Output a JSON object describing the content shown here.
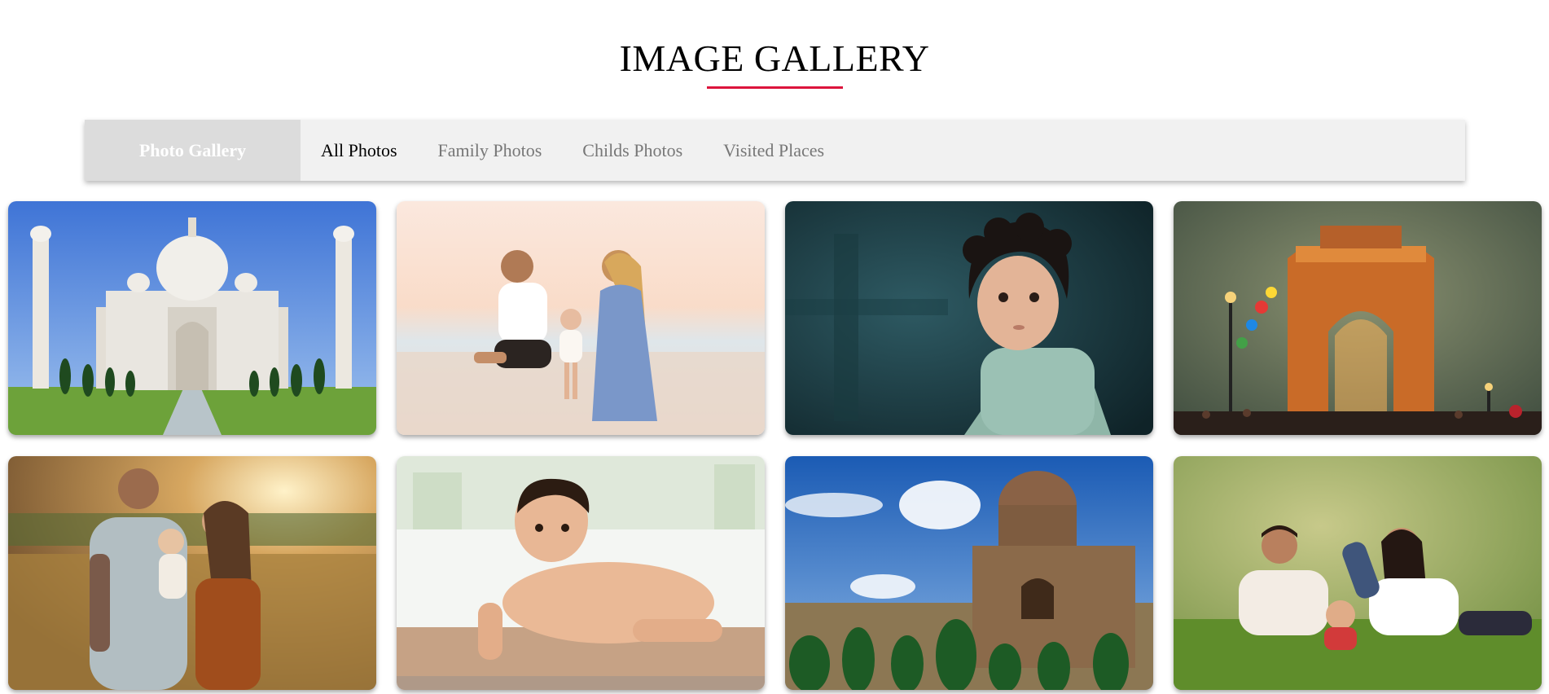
{
  "header": {
    "title": "IMAGE GALLERY",
    "accent_color": "#dc143c"
  },
  "filter_bar": {
    "brand": "Photo Gallery",
    "tabs": [
      {
        "label": "All Photos",
        "active": true
      },
      {
        "label": "Family Photos",
        "active": false
      },
      {
        "label": "Childs Photos",
        "active": false
      },
      {
        "label": "Visited Places",
        "active": false
      }
    ]
  },
  "gallery": {
    "photos": [
      {
        "subject": "taj-mahal",
        "category": "Visited Places"
      },
      {
        "subject": "family-beach",
        "category": "Family Photos"
      },
      {
        "subject": "curly-haired-boy",
        "category": "Childs Photos"
      },
      {
        "subject": "india-gate",
        "category": "Visited Places"
      },
      {
        "subject": "family-sunset-field",
        "category": "Family Photos"
      },
      {
        "subject": "crawling-baby",
        "category": "Childs Photos"
      },
      {
        "subject": "lodhi-garden-tomb",
        "category": "Visited Places"
      },
      {
        "subject": "family-on-grass",
        "category": "Family Photos"
      }
    ]
  }
}
